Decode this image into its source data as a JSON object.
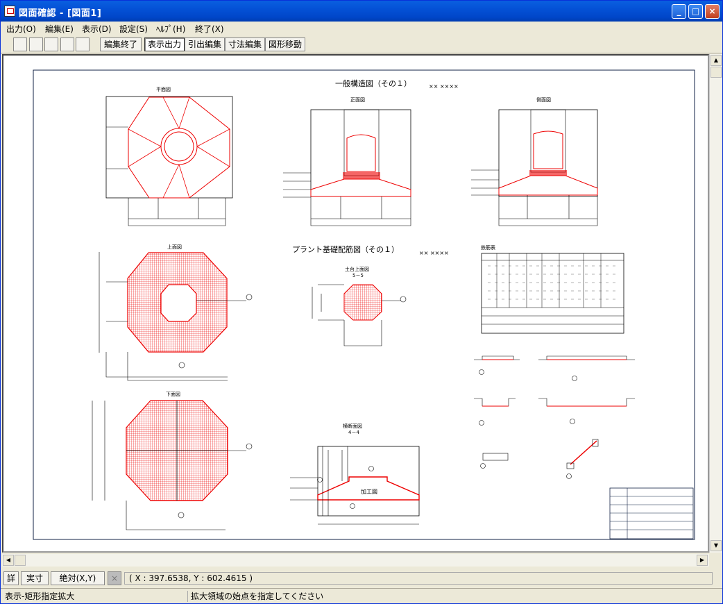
{
  "window": {
    "title": "図面確認 - [図面1]"
  },
  "menu": [
    "出力(O)",
    "編集(E)",
    "表示(D)",
    "設定(S)",
    "ﾍﾙﾌﾟ(H)",
    "終了(X)"
  ],
  "toolbar": {
    "buttons": [
      "編集終了",
      "表示出力",
      "引出編集",
      "寸法編集",
      "図形移動"
    ]
  },
  "drawing": {
    "main_title": "一般構造図（その１）",
    "main_title_suffix": "×× ××××",
    "views": {
      "plan": "平面図",
      "front": "正面図",
      "side": "側面図",
      "top": "上面図",
      "bottom": "下面図",
      "rebar_title": "プラント基礎配筋図（その１）",
      "rebar_suffix": "×× ××××",
      "section55": "土台上面図",
      "section55_sub": "5－5",
      "section44": "横断面図",
      "section44_sub": "4－4",
      "kakou": "加工図",
      "table_title": "鉄筋表"
    }
  },
  "cmdbar": {
    "btn1": "詳",
    "btn2": "実寸",
    "btn3": "絶対(X,Y)",
    "coords": "( X : 397.6538, Y : 602.4615 )"
  },
  "status": {
    "left": "表示-矩形指定拡大",
    "right": "拡大領域の始点を指定してください"
  }
}
